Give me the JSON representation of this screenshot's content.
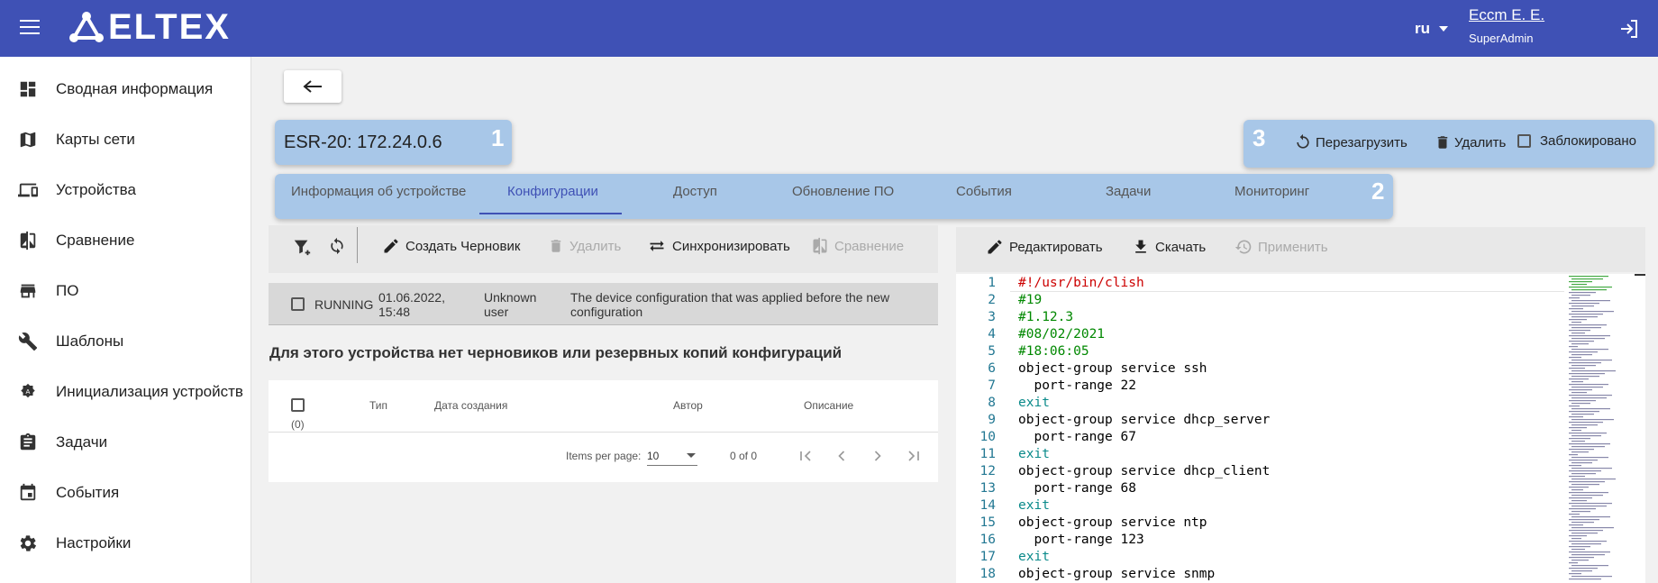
{
  "header": {
    "logo_text": "ELTEX",
    "lang": "ru",
    "user_name": "Eccm E. E.",
    "user_role": "SuperAdmin",
    "bg_color": "#3f51b5"
  },
  "sidebar": {
    "items": [
      {
        "label": "Сводная информация",
        "icon": "dashboard-icon"
      },
      {
        "label": "Карты сети",
        "icon": "map-icon"
      },
      {
        "label": "Устройства",
        "icon": "devices-icon"
      },
      {
        "label": "Сравнение",
        "icon": "compare-icon"
      },
      {
        "label": "ПО",
        "icon": "software-icon"
      },
      {
        "label": "Шаблоны",
        "icon": "wrench-icon"
      },
      {
        "label": "Инициализация устройств",
        "icon": "init-icon"
      },
      {
        "label": "Задачи",
        "icon": "tasks-icon"
      },
      {
        "label": "События",
        "icon": "events-icon"
      },
      {
        "label": "Настройки",
        "icon": "gear-icon"
      }
    ]
  },
  "device": {
    "title": "ESR-20: 172.24.0.6",
    "callouts": [
      "1",
      "2",
      "3"
    ]
  },
  "actions": {
    "reboot": "Перезагрузить",
    "delete": "Удалить",
    "locked": "Заблокировано"
  },
  "tabs": [
    {
      "label": "Информация об устройстве",
      "active": false
    },
    {
      "label": "Конфигурации",
      "active": true
    },
    {
      "label": "Доступ",
      "active": false
    },
    {
      "label": "Обновление ПО",
      "active": false
    },
    {
      "label": "События",
      "active": false
    },
    {
      "label": "Задачи",
      "active": false
    },
    {
      "label": "Мониторинг",
      "active": false
    }
  ],
  "config_toolbar": {
    "create_draft": "Создать Черновик",
    "delete": "Удалить",
    "sync": "Синхронизировать",
    "compare": "Сравнение"
  },
  "running_row": {
    "status": "RUNNING",
    "date": "01.06.2022,",
    "time": "15:48",
    "user_line1": "Unknown",
    "user_line2": "user",
    "desc_line1": "The device configuration that was applied before the new",
    "desc_line2": "configuration"
  },
  "empty_message": "Для этого устройства нет черновиков или резервных копий конфигураций",
  "table": {
    "selected_count": "(0)",
    "columns": [
      "Тип",
      "Дата создания",
      "Автор",
      "Описание"
    ],
    "items_per_page_label": "Items per page:",
    "items_per_page": "10",
    "range": "0 of 0"
  },
  "editor_toolbar": {
    "edit": "Редактировать",
    "download": "Скачать",
    "apply": "Применить"
  },
  "editor": {
    "lines": [
      {
        "n": "1",
        "text": "#!/usr/bin/clish",
        "cls": "c-red"
      },
      {
        "n": "2",
        "text": "#19",
        "cls": "c-green"
      },
      {
        "n": "3",
        "text": "#1.12.3",
        "cls": "c-green"
      },
      {
        "n": "4",
        "text": "#08/02/2021",
        "cls": "c-green"
      },
      {
        "n": "5",
        "text": "#18:06:05",
        "cls": "c-green"
      },
      {
        "n": "6",
        "text": "object-group service ssh",
        "cls": "c-black"
      },
      {
        "n": "7",
        "text": "  port-range 22",
        "cls": "c-black"
      },
      {
        "n": "8",
        "text": "exit",
        "cls": "c-exit"
      },
      {
        "n": "9",
        "text": "object-group service dhcp_server",
        "cls": "c-black"
      },
      {
        "n": "10",
        "text": "  port-range 67",
        "cls": "c-black"
      },
      {
        "n": "11",
        "text": "exit",
        "cls": "c-exit"
      },
      {
        "n": "12",
        "text": "object-group service dhcp_client",
        "cls": "c-black"
      },
      {
        "n": "13",
        "text": "  port-range 68",
        "cls": "c-black"
      },
      {
        "n": "14",
        "text": "exit",
        "cls": "c-exit"
      },
      {
        "n": "15",
        "text": "object-group service ntp",
        "cls": "c-black"
      },
      {
        "n": "16",
        "text": "  port-range 123",
        "cls": "c-black"
      },
      {
        "n": "17",
        "text": "exit",
        "cls": "c-exit"
      },
      {
        "n": "18",
        "text": "object-group service snmp",
        "cls": "c-black"
      }
    ]
  }
}
